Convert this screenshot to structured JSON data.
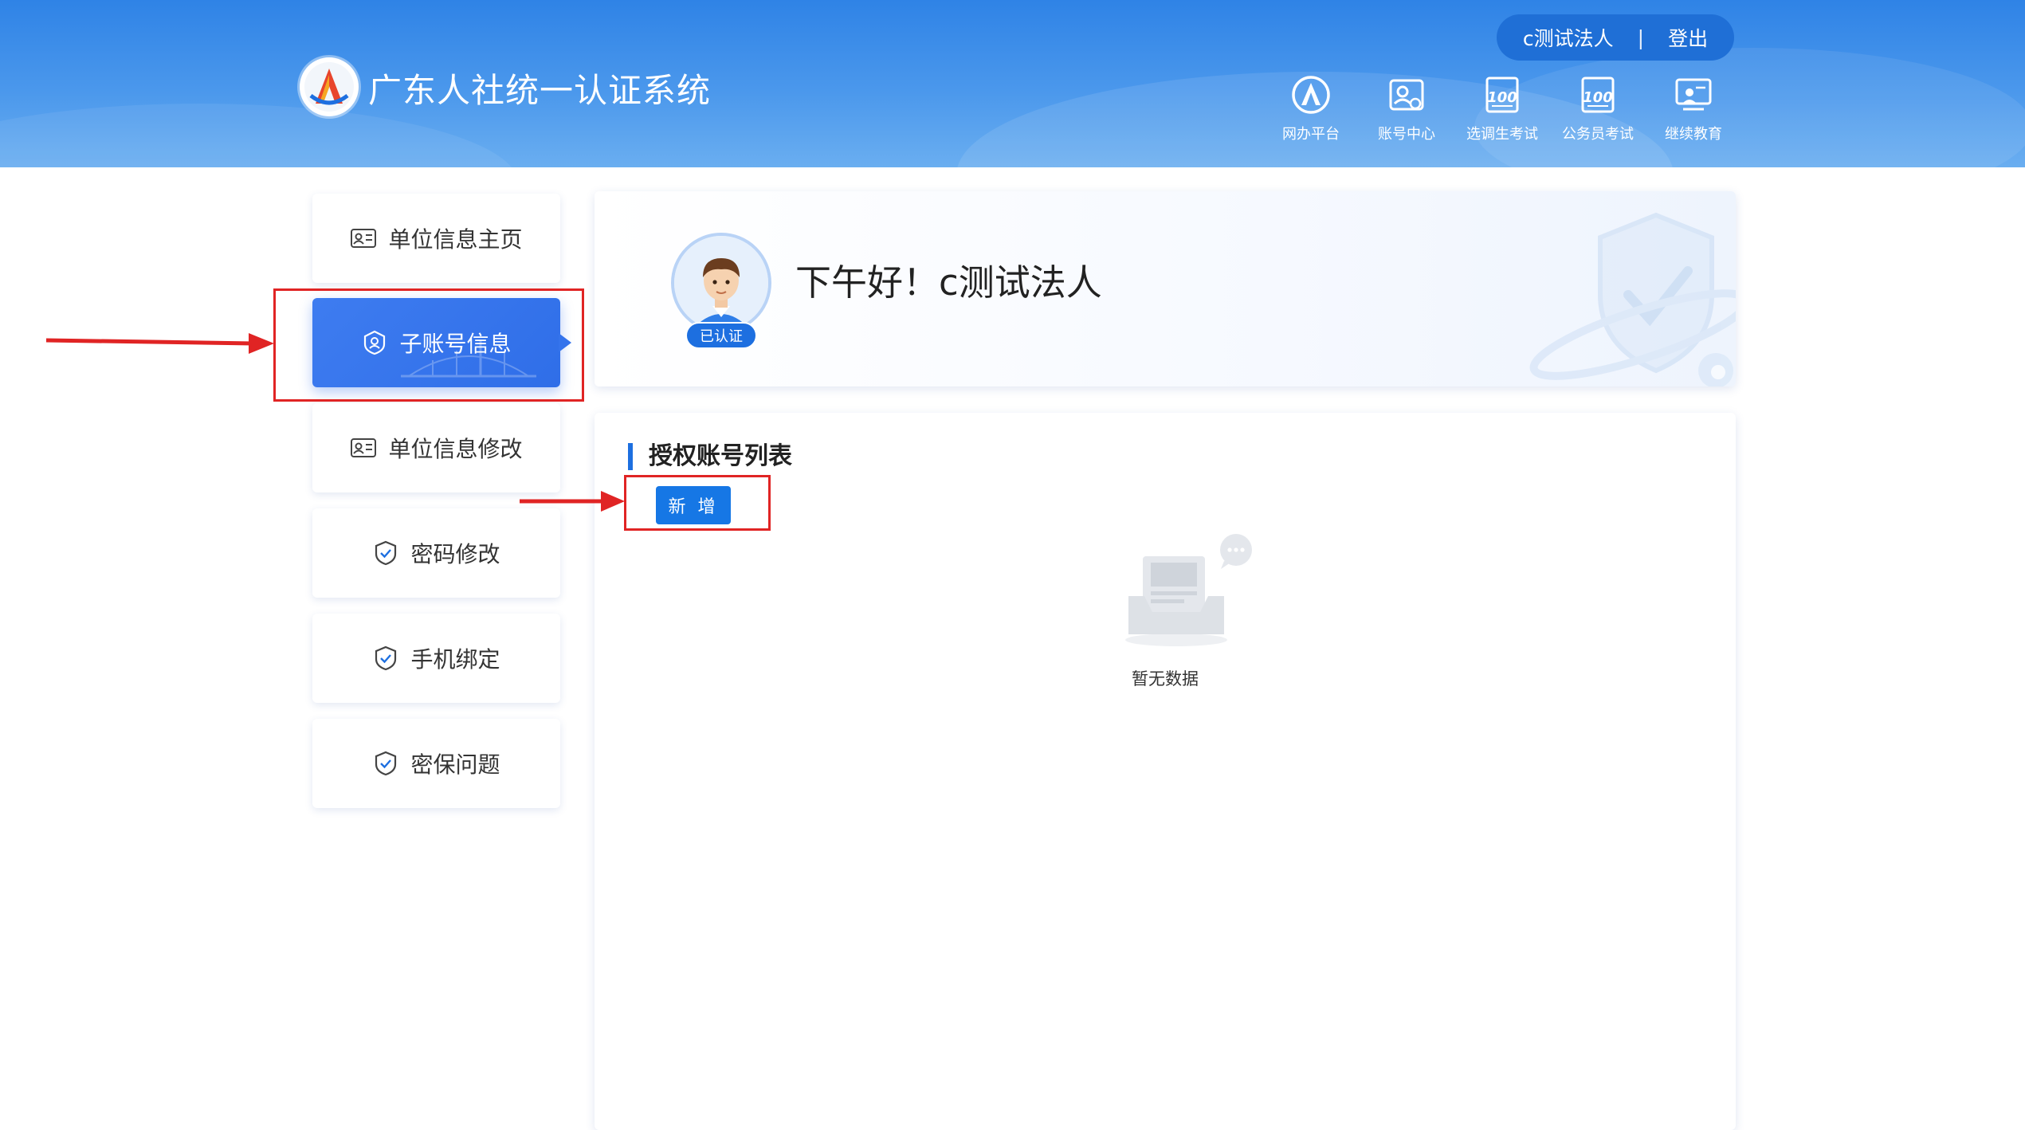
{
  "header": {
    "site_title": "广东人社统一认证系统",
    "user_name": "c测试法人",
    "separator": "|",
    "logout_label": "登出",
    "nav_items": [
      {
        "label": "网办平台",
        "icon": "portal-icon"
      },
      {
        "label": "账号中心",
        "icon": "account-center-icon"
      },
      {
        "label": "选调生考试",
        "icon": "exam-score-icon"
      },
      {
        "label": "公务员考试",
        "icon": "exam-score-icon"
      },
      {
        "label": "继续教育",
        "icon": "education-icon"
      }
    ]
  },
  "sidebar": {
    "items": [
      {
        "label": "单位信息主页",
        "icon": "id-card-icon",
        "active": false
      },
      {
        "label": "子账号信息",
        "icon": "badge-icon",
        "active": true
      },
      {
        "label": "单位信息修改",
        "icon": "id-card-icon",
        "active": false
      },
      {
        "label": "密码修改",
        "icon": "shield-check-icon",
        "active": false
      },
      {
        "label": "手机绑定",
        "icon": "shield-check-icon",
        "active": false
      },
      {
        "label": "密保问题",
        "icon": "shield-check-icon",
        "active": false
      }
    ]
  },
  "welcome": {
    "greeting": "下午好！c测试法人",
    "verified_badge": "已认证"
  },
  "list": {
    "title": "授权账号列表",
    "add_label": "新 增",
    "empty_text": "暂无数据"
  },
  "colors": {
    "primary": "#1677e5",
    "header_blue": "#2f83e6",
    "annotation_red": "#e02424"
  }
}
